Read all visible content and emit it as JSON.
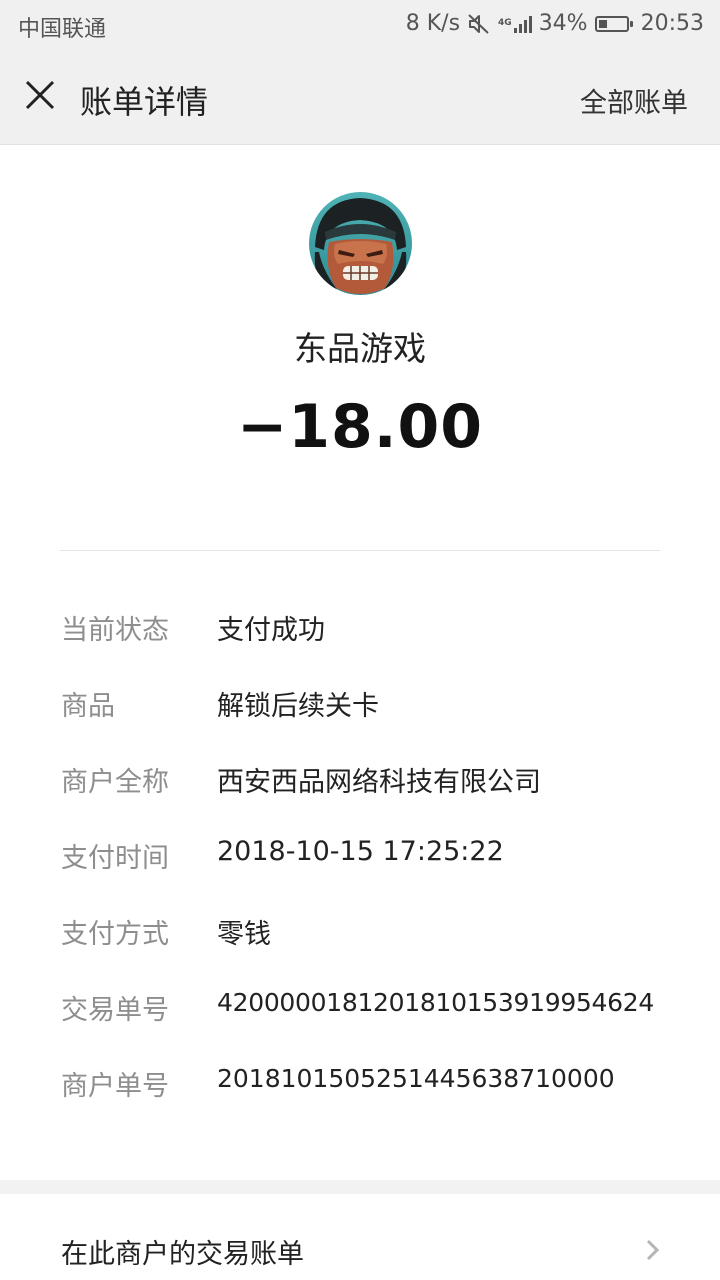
{
  "status_bar": {
    "carrier": "中国联通",
    "speed": "8 K/s",
    "network": "4G",
    "battery_percent": "34%",
    "battery_level": 0.34,
    "time": "20:53",
    "icons": [
      "mute-icon",
      "signal-icon",
      "battery-icon"
    ]
  },
  "header": {
    "title": "账单详情",
    "right_link": "全部账单",
    "close_icon": "close-icon"
  },
  "merchant": {
    "name": "东品游戏",
    "amount": "−18.00",
    "avatar_icon": "game-character-avatar"
  },
  "details": [
    {
      "label": "当前状态",
      "value": "支付成功"
    },
    {
      "label": "商品",
      "value": "解锁后续关卡"
    },
    {
      "label": "商户全称",
      "value": "西安西品网络科技有限公司"
    },
    {
      "label": "支付时间",
      "value": "2018-10-15 17:25:22"
    },
    {
      "label": "支付方式",
      "value": "零钱"
    },
    {
      "label": "交易单号",
      "value": "4200000181201810153919954624"
    },
    {
      "label": "商户单号",
      "value": "2018101505251445638710000"
    }
  ],
  "footer_link": {
    "label": "在此商户的交易账单",
    "chevron_icon": "chevron-right-icon"
  },
  "colors": {
    "header_bg": "#f0f0f0",
    "label_gray": "#8e8e8e",
    "text_dark": "#222222"
  }
}
